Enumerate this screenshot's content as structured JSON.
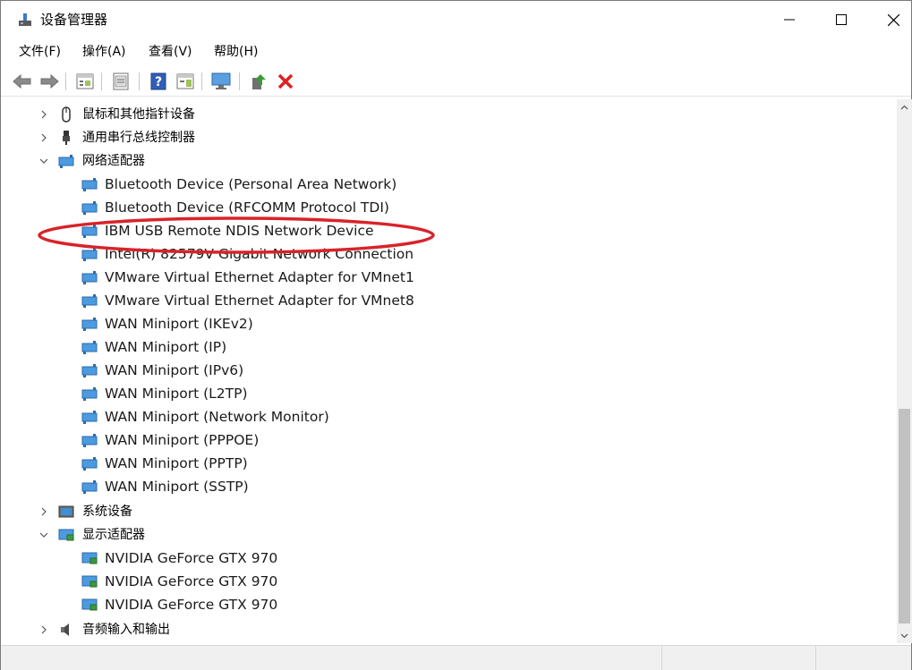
{
  "window": {
    "title": "设备管理器",
    "controls": {
      "minimize": "minimize-icon",
      "maximize": "maximize-icon",
      "close": "close-icon"
    }
  },
  "menu": [
    {
      "label": "文件(F)"
    },
    {
      "label": "操作(A)"
    },
    {
      "label": "查看(V)"
    },
    {
      "label": "帮助(H)"
    }
  ],
  "toolbar": {
    "buttons": [
      "back-icon",
      "forward-icon",
      "device-view-icon",
      "properties-icon",
      "help-icon",
      "action-pane-icon",
      "monitor-icon",
      "update-driver-icon",
      "uninstall-icon"
    ],
    "colors": {
      "help": "#2f5fb8",
      "uninstall": "#e02020",
      "update": "#3a9a3a"
    }
  },
  "tree": {
    "categories": {
      "mice": {
        "label": "鼠标和其他指针设备",
        "expanded": false,
        "icon": "mouse-icon"
      },
      "usb": {
        "label": "通用串行总线控制器",
        "expanded": false,
        "icon": "usb-icon"
      },
      "network": {
        "label": "网络适配器",
        "expanded": true,
        "icon": "network-adapter-icon",
        "devices": [
          "Bluetooth Device (Personal Area Network)",
          "Bluetooth Device (RFCOMM Protocol TDI)",
          "IBM USB Remote NDIS Network Device",
          "Intel(R) 82579V Gigabit Network Connection",
          "VMware Virtual Ethernet Adapter for VMnet1",
          "VMware Virtual Ethernet Adapter for VMnet8",
          "WAN Miniport (IKEv2)",
          "WAN Miniport (IP)",
          "WAN Miniport (IPv6)",
          "WAN Miniport (L2TP)",
          "WAN Miniport (Network Monitor)",
          "WAN Miniport (PPPOE)",
          "WAN Miniport (PPTP)",
          "WAN Miniport (SSTP)"
        ]
      },
      "system": {
        "label": "系统设备",
        "expanded": false,
        "icon": "system-devices-icon"
      },
      "display": {
        "label": "显示适配器",
        "expanded": true,
        "icon": "display-adapter-icon",
        "devices": [
          "NVIDIA GeForce GTX 970",
          "NVIDIA GeForce GTX 970",
          "NVIDIA GeForce GTX 970"
        ]
      },
      "audio": {
        "label": "音频输入和输出",
        "expanded": false,
        "icon": "speaker-icon"
      }
    }
  },
  "annotation": {
    "highlighted_device": "IBM USB Remote NDIS Network Device",
    "color": "#d8232a"
  }
}
